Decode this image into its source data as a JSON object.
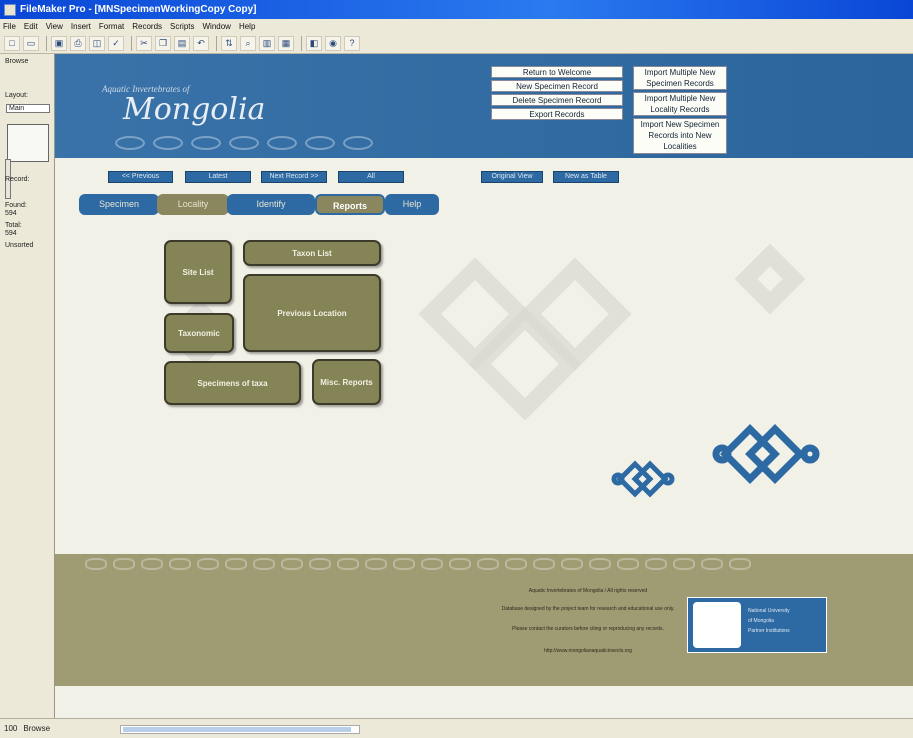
{
  "window": {
    "title": "FileMaker Pro - [MNSpecimenWorkingCopy Copy]"
  },
  "menu": [
    "File",
    "Edit",
    "View",
    "Insert",
    "Format",
    "Records",
    "Scripts",
    "Window",
    "Help"
  ],
  "toolbar": {
    "icons": [
      "new-icon",
      "open-icon",
      "save-icon",
      "print-icon",
      "preview-icon",
      "spell-icon",
      "cut-icon",
      "copy-icon",
      "paste-icon",
      "undo-icon",
      "sort-icon",
      "find-icon",
      "chart-icon",
      "table-icon",
      "layout-icon",
      "browse-icon",
      "help-icon"
    ]
  },
  "statusarea": {
    "mode": "Browse",
    "layout_label": "Layout:",
    "layout_value": "Main",
    "record_label": "Record:",
    "found_label": "Found:",
    "found_value": "594",
    "total_label": "Total:",
    "total_value": "594",
    "unsorted": "Unsorted"
  },
  "header": {
    "subtitle": "Aquatic Invertebrates of",
    "title": "Mongolia",
    "buttons": {
      "return_welcome": "Return to Welcome",
      "new_specimen": "New Specimen Record",
      "delete_specimen": "Delete Specimen Record",
      "export_records": "Export Records",
      "import_multiple_new": "Import Multiple New Specimen Records",
      "import_locality": "Import Multiple New Locality Records",
      "import_into_new": "Import New Specimen Records into New Localities"
    }
  },
  "nav": {
    "previous": "<< Previous",
    "latest": "Latest",
    "next": "Next Record >>",
    "blank": "All",
    "original_view": "Original View",
    "new_table": "New as Table"
  },
  "tabs": {
    "tab1": "Specimen",
    "tab2": "Locality",
    "tab3": "Identify",
    "tab4": "Reports",
    "tab5": "Help"
  },
  "reports": {
    "taxon_list": "Taxon List",
    "site_list": "Site List",
    "taxonomic": "Taxonomic",
    "previous_location": "Previous Location",
    "specimens_by_taxa": "Specimens of taxa",
    "misc_reports": "Misc. Reports"
  },
  "footer": {
    "line1": "Aquatic Invertebrates of Mongolia / All rights reserved",
    "line2": "Database designed by the project team for research and educational use only.",
    "line3": "Please contact the curators before citing or reproducing any records.",
    "line4": "http://www.mongolianaquaticinsects.org",
    "partner_lines": [
      "National University",
      "of Mongolia",
      "Partner Institutions"
    ]
  },
  "statusbar": {
    "zoom": "100",
    "mode": "Browse"
  },
  "colors": {
    "header_blue": "#2d6aa3",
    "olive": "#858457",
    "footer_olive": "#9f9b73",
    "background": "#f1f1e8"
  }
}
